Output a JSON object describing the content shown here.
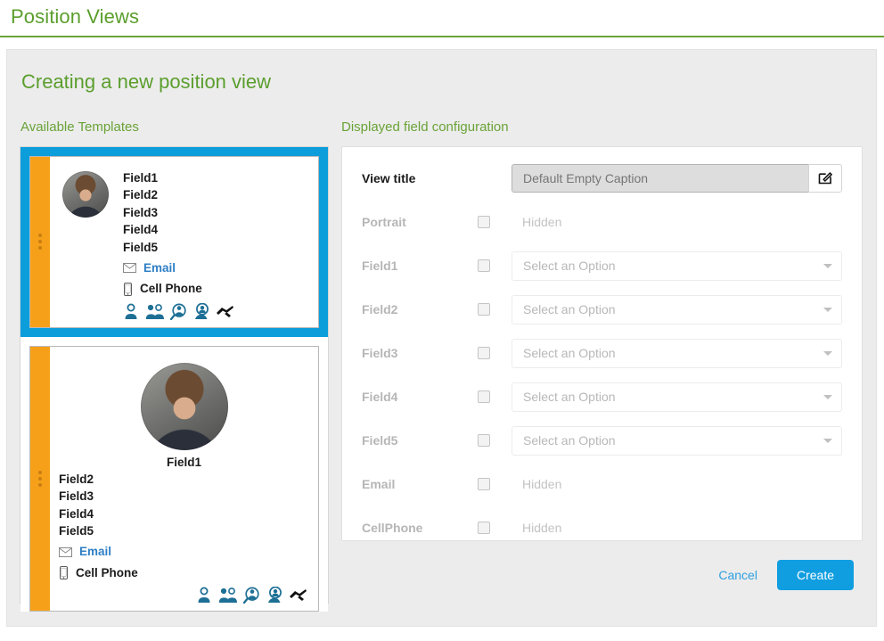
{
  "page": {
    "title": "Position Views",
    "panel_title": "Creating a new position view",
    "accent_green": "#5b9e2d",
    "accent_blue": "#119ee0",
    "accent_orange": "#f6a01a"
  },
  "sections": {
    "templates_label": "Available Templates",
    "config_label": "Displayed field configuration"
  },
  "templates": [
    {
      "name": "horizontal-template",
      "selected": true,
      "fields": [
        "Field1",
        "Field2",
        "Field3",
        "Field4",
        "Field5"
      ],
      "email_label": "Email",
      "cellphone_label": "Cell Phone",
      "action_icons": [
        "person-icon",
        "group-icon",
        "person-search-icon",
        "person-chat-icon",
        "handshake-icon"
      ]
    },
    {
      "name": "vertical-template",
      "selected": false,
      "title_field": "Field1",
      "fields": [
        "Field2",
        "Field3",
        "Field4",
        "Field5"
      ],
      "email_label": "Email",
      "cellphone_label": "Cell Phone",
      "action_icons": [
        "person-icon",
        "group-icon",
        "person-search-icon",
        "person-chat-icon",
        "handshake-icon"
      ]
    }
  ],
  "config": {
    "view_title": {
      "label": "View title",
      "placeholder": "Default Empty Caption",
      "value": "",
      "edit_icon": "edit-square-icon"
    },
    "rows": [
      {
        "label": "Portrait",
        "checked": false,
        "control": "static",
        "value": "Hidden"
      },
      {
        "label": "Field1",
        "checked": false,
        "control": "select",
        "value": "Select an Option"
      },
      {
        "label": "Field2",
        "checked": false,
        "control": "select",
        "value": "Select an Option"
      },
      {
        "label": "Field3",
        "checked": false,
        "control": "select",
        "value": "Select an Option"
      },
      {
        "label": "Field4",
        "checked": false,
        "control": "select",
        "value": "Select an Option"
      },
      {
        "label": "Field5",
        "checked": false,
        "control": "select",
        "value": "Select an Option"
      },
      {
        "label": "Email",
        "checked": false,
        "control": "static",
        "value": "Hidden"
      },
      {
        "label": "CellPhone",
        "checked": false,
        "control": "static",
        "value": "Hidden"
      }
    ]
  },
  "footer": {
    "cancel_label": "Cancel",
    "create_label": "Create"
  }
}
